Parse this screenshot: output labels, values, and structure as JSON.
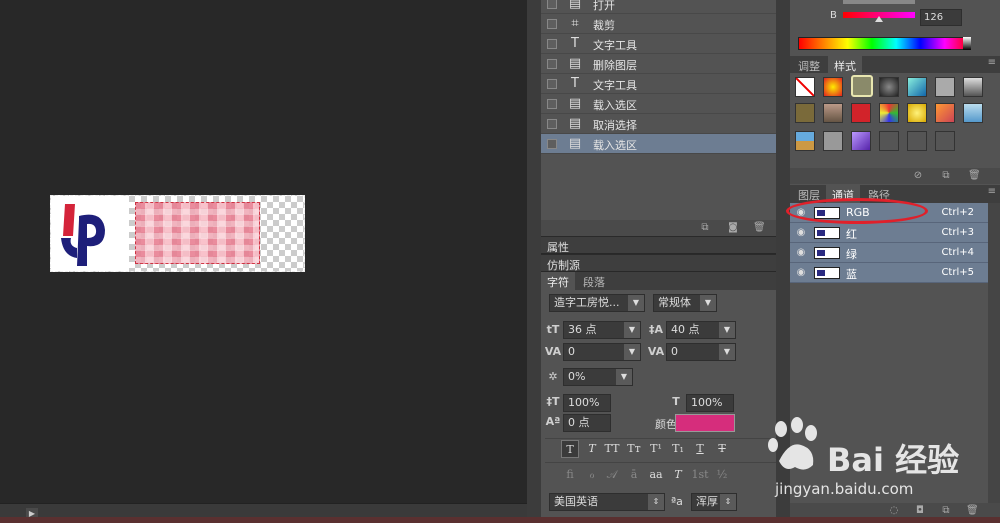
{
  "history": {
    "items": [
      {
        "label": "打开",
        "icon": "document-icon",
        "selected": false
      },
      {
        "label": "裁剪",
        "icon": "crop-icon",
        "selected": false
      },
      {
        "label": "文字工具",
        "icon": "type-icon",
        "selected": false
      },
      {
        "label": "删除图层",
        "icon": "document-icon",
        "selected": false
      },
      {
        "label": "文字工具",
        "icon": "type-icon",
        "selected": false
      },
      {
        "label": "载入选区",
        "icon": "document-icon",
        "selected": false
      },
      {
        "label": "取消选择",
        "icon": "document-icon",
        "selected": false
      },
      {
        "label": "载入选区",
        "icon": "document-icon",
        "selected": true
      }
    ]
  },
  "panels": {
    "properties": "属性",
    "clone_source": "仿制源"
  },
  "character": {
    "tabs": [
      "字符",
      "段落"
    ],
    "font_family": "造字工房悦...",
    "font_style": "常规体",
    "font_size": "36 点",
    "leading": "40 点",
    "kerning": "0",
    "tracking": "0",
    "scale_tsume": "0%",
    "vertical_scale": "100%",
    "horizontal_scale": "100%",
    "baseline_shift": "0 点",
    "color_label": "颜色:",
    "color_value": "#d62d7c",
    "language": "美国英语",
    "antialias": "浑厚"
  },
  "color": {
    "channel_label": "B",
    "channel_value": "126"
  },
  "styles": {
    "tabs": [
      "调整",
      "样式"
    ]
  },
  "channels": {
    "tabs": [
      "图层",
      "通道",
      "路径"
    ],
    "items": [
      {
        "name": "RGB",
        "shortcut": "Ctrl+2"
      },
      {
        "name": "红",
        "shortcut": "Ctrl+3"
      },
      {
        "name": "绿",
        "shortcut": "Ctrl+4"
      },
      {
        "name": "蓝",
        "shortcut": "Ctrl+5"
      }
    ]
  },
  "watermark": {
    "brand": "Bai 经验",
    "url": "jingyan.baidu.com"
  }
}
